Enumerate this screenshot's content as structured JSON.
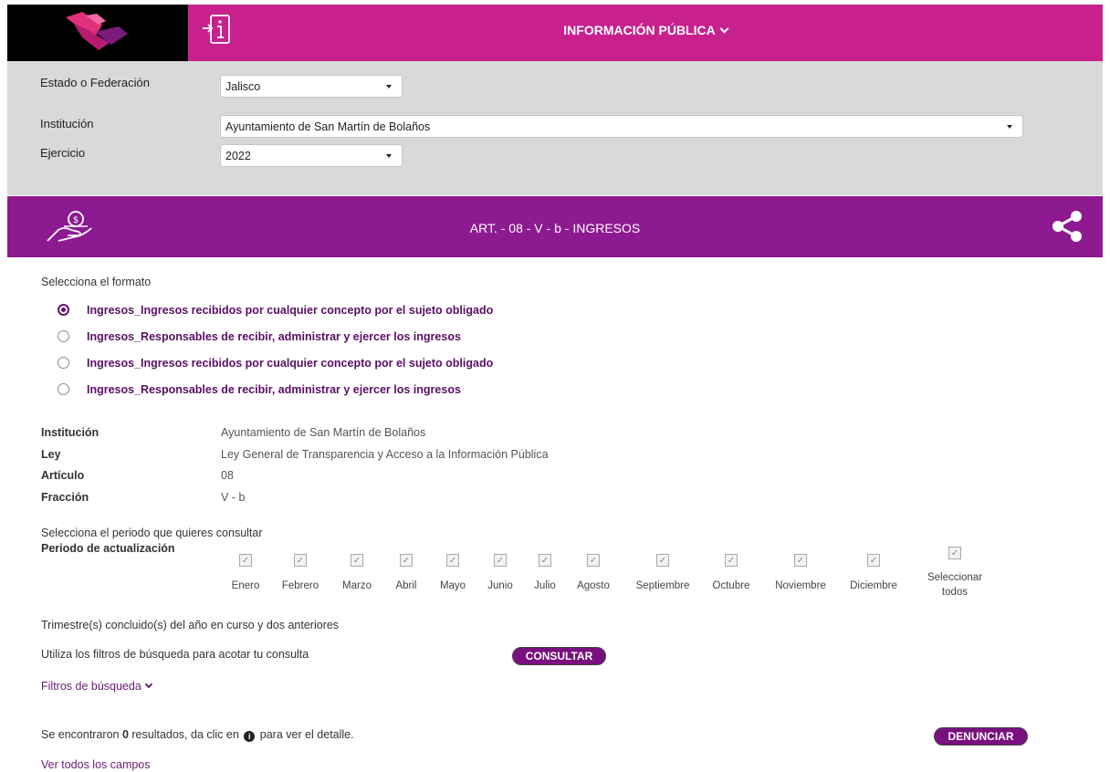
{
  "header": {
    "title": "INFORMACIÓN PÚBLICA",
    "colors": {
      "brand": "#c8218e",
      "band": "#8e1a92",
      "button": "#7a0f80"
    }
  },
  "filters": {
    "estado_label": "Estado o Federación",
    "estado_value": "Jalisco",
    "institucion_label": "Institución",
    "institucion_value": "Ayuntamiento de San Martín de Bolaños",
    "ejercicio_label": "Ejercicio",
    "ejercicio_value": "2022"
  },
  "article": {
    "title": "ART. - 08 - V - b - INGRESOS"
  },
  "formato": {
    "prompt": "Selecciona el formato",
    "options": [
      "Ingresos_Ingresos recibidos por cualquier concepto por el sujeto obligado",
      "Ingresos_Responsables de recibir, administrar y ejercer los ingresos",
      "Ingresos_Ingresos recibidos por cualquier concepto por el sujeto obligado",
      "Ingresos_Responsables de recibir, administrar y ejercer los ingresos"
    ]
  },
  "details": {
    "institucion_key": "Institución",
    "institucion_val": "Ayuntamiento de San Martín de Bolaños",
    "ley_key": "Ley",
    "ley_val": "Ley General de Transparencia y Acceso a la Información Pública",
    "articulo_key": "Artículo",
    "articulo_val": "08",
    "fraccion_key": "Fracción",
    "fraccion_val": "V - b"
  },
  "periodo": {
    "prompt": "Selecciona el periodo que quieres consultar",
    "label": "Periodo de actualización",
    "months": [
      "Enero",
      "Febrero",
      "Marzo",
      "Abril",
      "Mayo",
      "Junio",
      "Julio",
      "Agosto",
      "Septiembre",
      "Octubre",
      "Noviembre",
      "Diciembre"
    ],
    "select_all_1": "Seleccionar",
    "select_all_2": "todos"
  },
  "footer": {
    "trimestres": "Trimestre(s) concluido(s) del año en curso y dos anteriores",
    "filtros_hint": "Utiliza los filtros de búsqueda para acotar tu consulta",
    "consultar": "CONSULTAR",
    "filtros_link": "Filtros de búsqueda",
    "results_pre": "Se encontraron ",
    "results_count": "0",
    "results_mid": " resultados, da clic en ",
    "results_post": " para ver el detalle.",
    "denunciar": "DENUNCIAR",
    "ver_todos": "Ver todos los campos"
  }
}
